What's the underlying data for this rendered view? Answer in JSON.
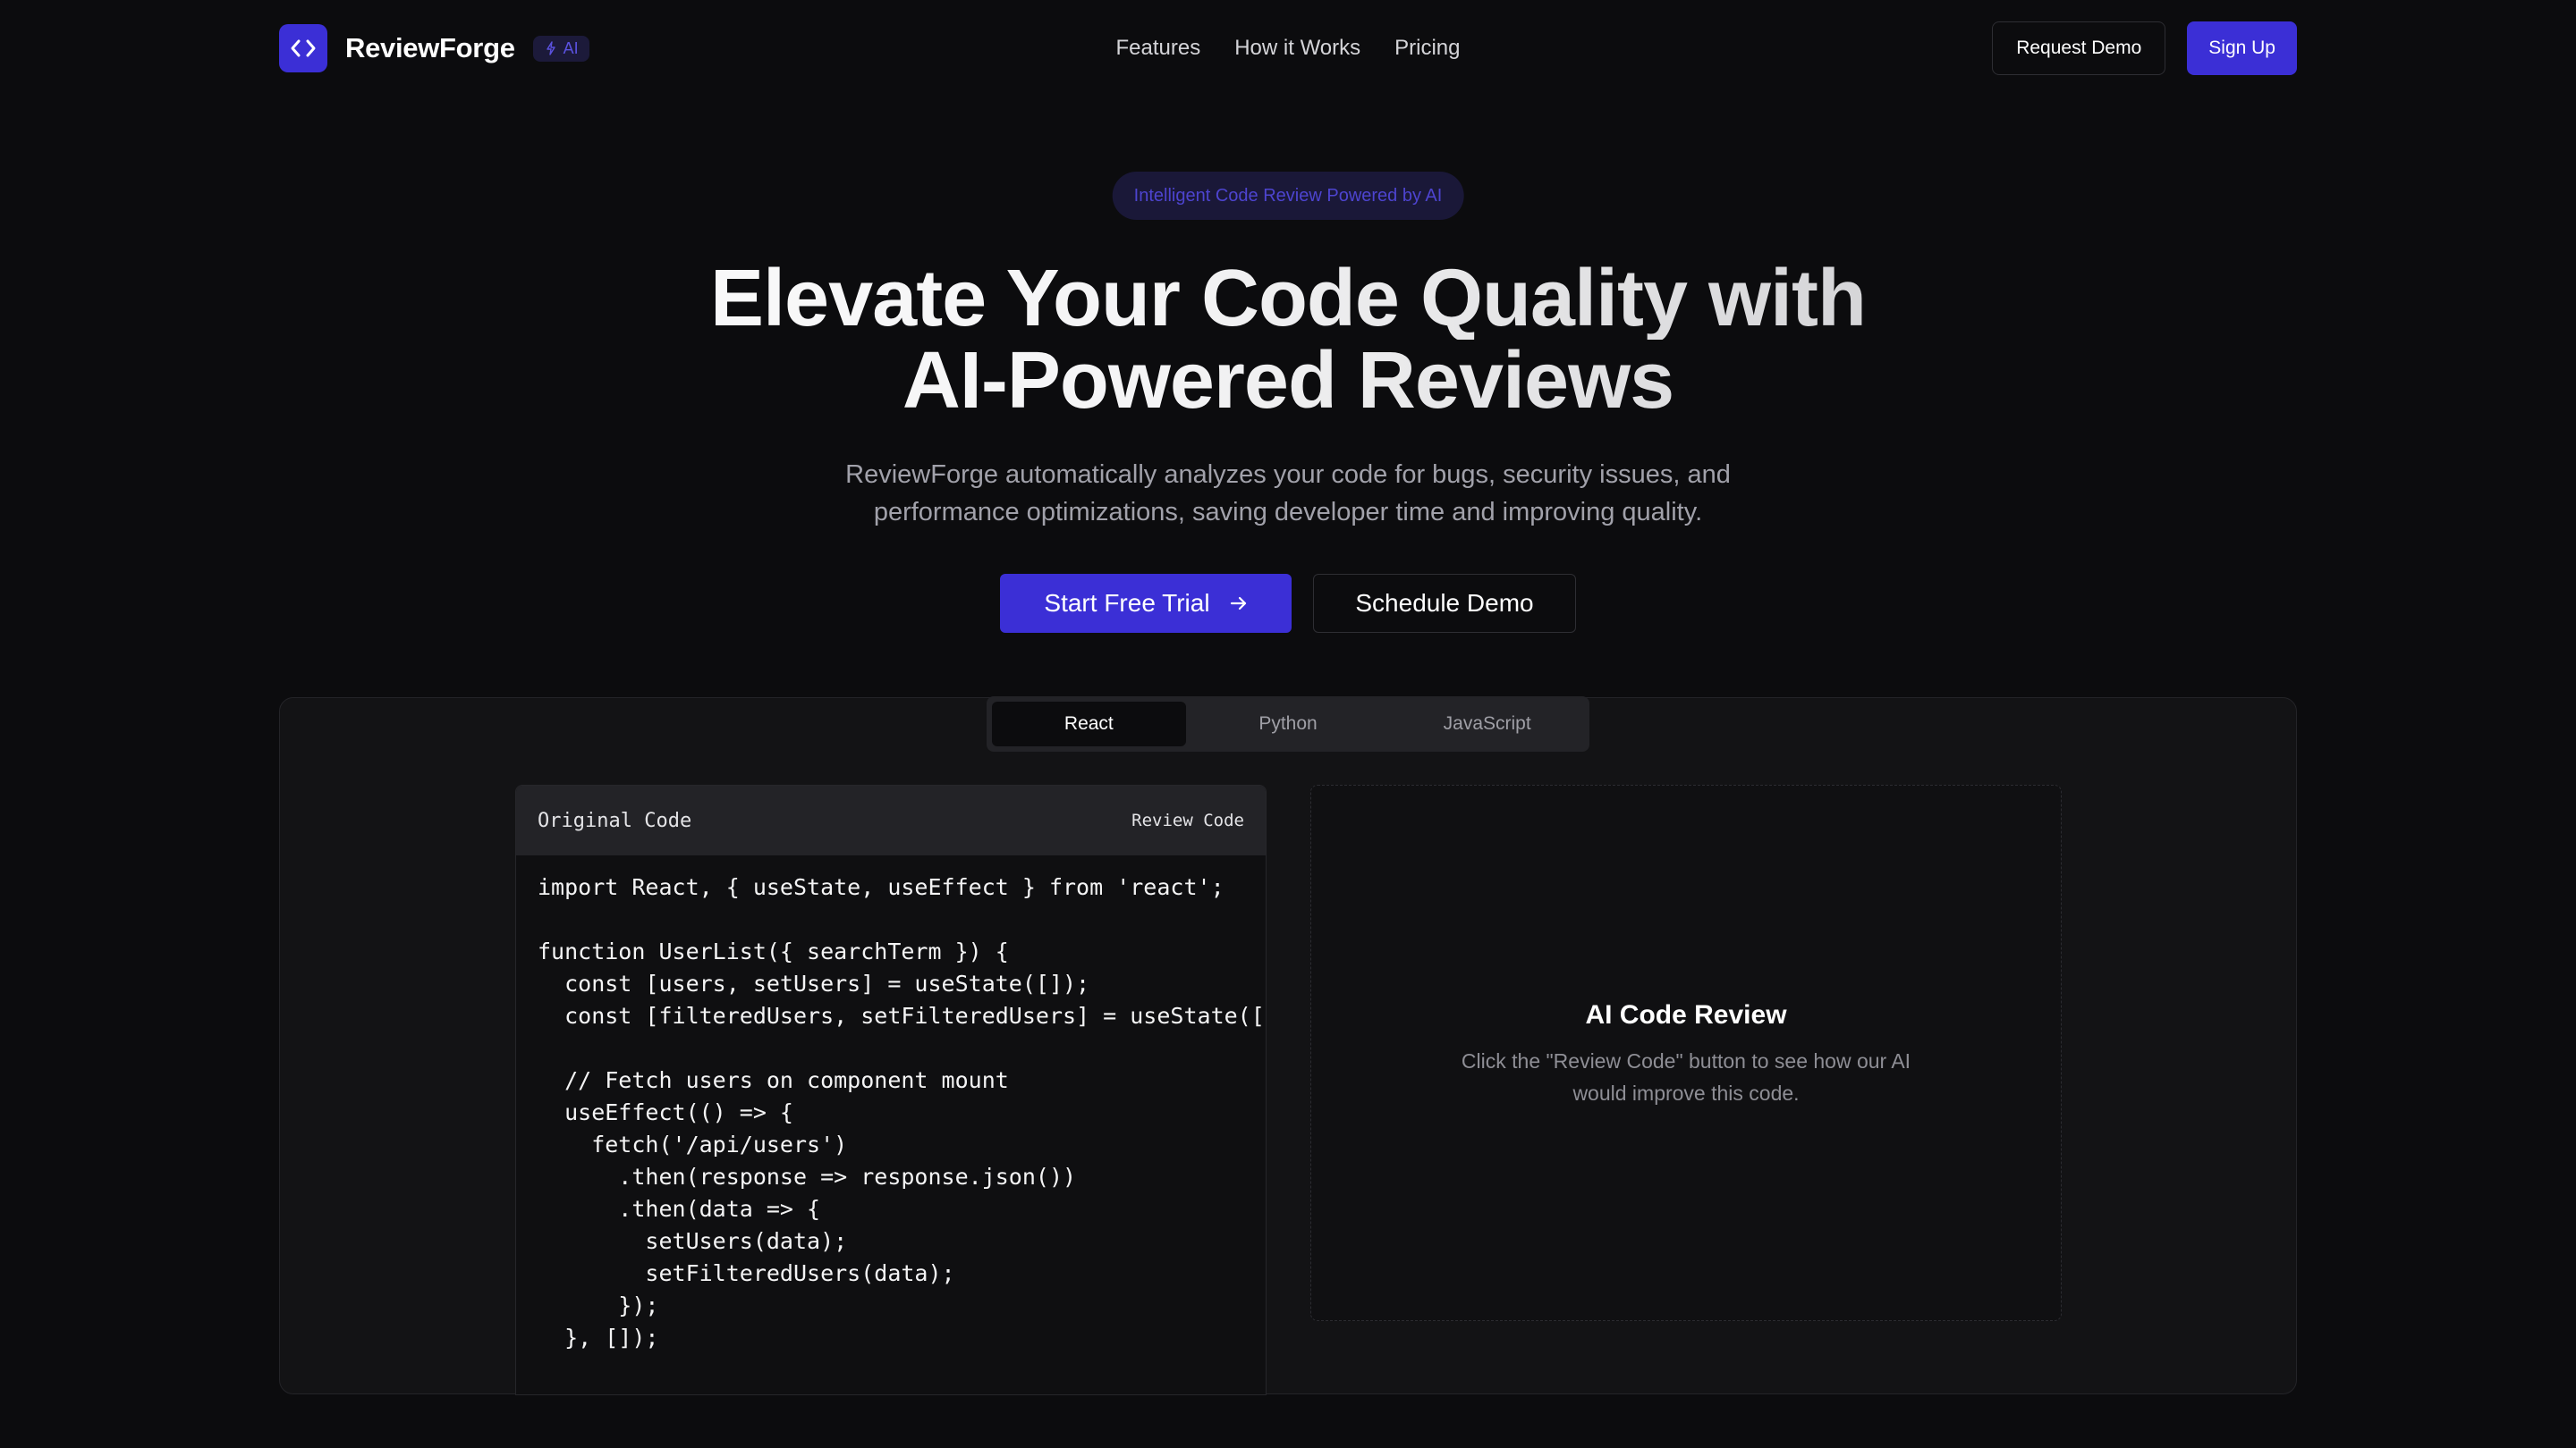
{
  "nav": {
    "brand_name": "ReviewForge",
    "ai_badge": "AI",
    "links": [
      "Features",
      "How it Works",
      "Pricing"
    ],
    "request_demo": "Request Demo",
    "sign_up": "Sign Up"
  },
  "hero": {
    "pill": "Intelligent Code Review Powered by AI",
    "title_line1": "Elevate Your Code Quality with",
    "title_line2": "AI-Powered Reviews",
    "subtitle": "ReviewForge automatically analyzes your code for bugs, security issues, and performance optimizations, saving developer time and improving quality.",
    "cta_primary": "Start Free Trial",
    "cta_secondary": "Schedule Demo"
  },
  "demo": {
    "tabs": [
      {
        "label": "React",
        "active": true
      },
      {
        "label": "Python",
        "active": false
      },
      {
        "label": "JavaScript",
        "active": false
      }
    ],
    "code_card": {
      "title": "Original Code",
      "review_button": "Review Code",
      "code": "import React, { useState, useEffect } from 'react';\n\nfunction UserList({ searchTerm }) {\n  const [users, setUsers] = useState([]);\n  const [filteredUsers, setFilteredUsers] = useState([]);\n\n  // Fetch users on component mount\n  useEffect(() => {\n    fetch('/api/users')\n      .then(response => response.json())\n      .then(data => {\n        setUsers(data);\n        setFilteredUsers(data);\n      });\n  }, []);"
    },
    "review_card": {
      "title": "AI Code Review",
      "description": "Click the \"Review Code\" button to see how our AI would improve this code."
    }
  },
  "colors": {
    "background": "#0c0c0e",
    "accent": "#3b2fd6",
    "panel": "#131315",
    "muted_text": "#a1a1aa"
  },
  "icons": {
    "logo": "code-brackets-icon",
    "ai_badge": "sparkle-icon",
    "cta_arrow": "arrow-right-icon"
  }
}
